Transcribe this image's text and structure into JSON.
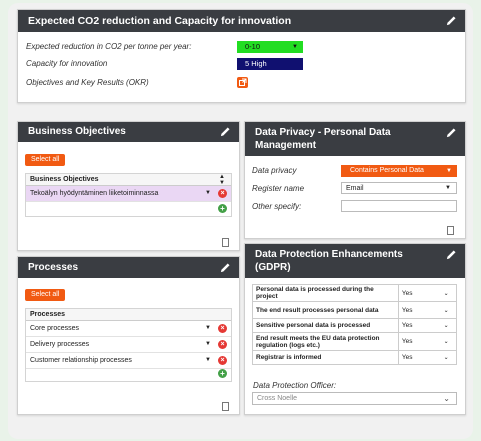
{
  "co2_panel": {
    "title": "Expected CO2 reduction and Capacity for innovation",
    "reduction_label": "Expected reduction in CO2 per tonne per year",
    "reduction_value": "0-10",
    "capacity_label": "Capacity for innovation",
    "capacity_value": "5 High",
    "okr_label": "Objectives and Key Results (OKR)"
  },
  "business_objectives": {
    "title": "Business Objectives",
    "select_all": "Select all",
    "column_header": "Business Objectives",
    "rows": [
      "Tekoälyn hyödyntäminen liiketoiminnassa"
    ]
  },
  "processes": {
    "title": "Processes",
    "select_all": "Select all",
    "column_header": "Processes",
    "rows": [
      "Core processes",
      "Delivery processes",
      "Customer relationship processes"
    ]
  },
  "data_privacy": {
    "title": "Data Privacy - Personal Data Management",
    "privacy_label": "Data privacy",
    "privacy_value": "Contains Personal Data",
    "register_label": "Register name",
    "register_value": "Email",
    "other_label": "Other specify:",
    "other_value": ""
  },
  "gdpr": {
    "title": "Data Protection Enhancements (GDPR)",
    "rows": [
      {
        "question": "Personal data is processed during the project",
        "answer": "Yes"
      },
      {
        "question": "The end result processes personal data",
        "answer": "Yes"
      },
      {
        "question": "Sensitive personal data is processed",
        "answer": "Yes"
      },
      {
        "question": "End result meets the EU data protection regulation (logs etc.)",
        "answer": "Yes"
      },
      {
        "question": "Registrar is informed",
        "answer": "Yes"
      }
    ],
    "dpo_label": "Data Protection Officer:",
    "dpo_value": "Cross Noelle"
  },
  "colors": {
    "header_bg": "#3a3d42",
    "orange": "#f15a12",
    "green_select": "#22dd22",
    "navy_select": "#101070",
    "remove_red": "#e53935",
    "add_green": "#43a047"
  }
}
